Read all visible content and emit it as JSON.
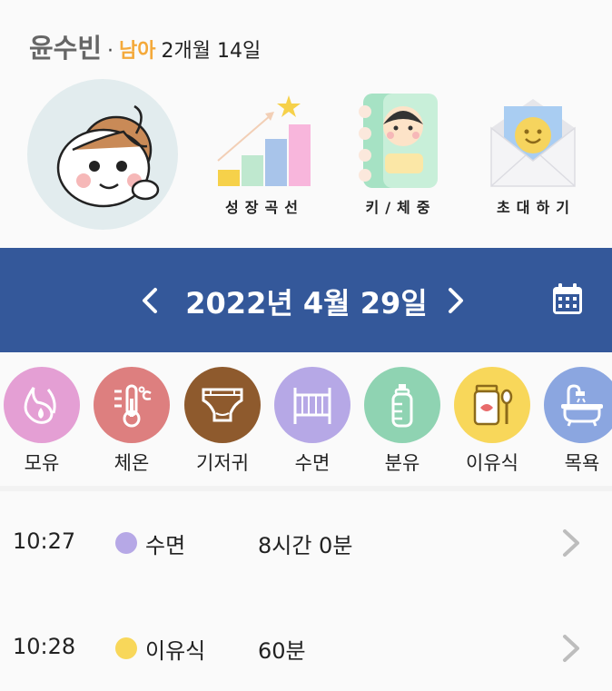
{
  "profile": {
    "name": "윤수빈",
    "separator": "·",
    "gender": "남아",
    "age": "2개월 14일"
  },
  "menu": [
    {
      "label": "성장곡선",
      "icon": "growth-chart-icon"
    },
    {
      "label": "키/체중",
      "icon": "height-weight-book-icon"
    },
    {
      "label": "초대하기",
      "icon": "invite-envelope-icon"
    }
  ],
  "date_bar": {
    "date": "2022년 4월 29일",
    "prev_icon": "chevron-left-icon",
    "next_icon": "chevron-right-icon",
    "calendar_icon": "calendar-icon"
  },
  "categories": [
    {
      "label": "모유",
      "icon": "breast-milk-icon",
      "color": "#e49fd4"
    },
    {
      "label": "체온",
      "icon": "thermometer-icon",
      "color": "#dd7f7f"
    },
    {
      "label": "기저귀",
      "icon": "diaper-icon",
      "color": "#8e5a2d"
    },
    {
      "label": "수면",
      "icon": "crib-icon",
      "color": "#b6a8e6"
    },
    {
      "label": "분유",
      "icon": "baby-bottle-icon",
      "color": "#8fd3b2"
    },
    {
      "label": "이유식",
      "icon": "baby-food-icon",
      "color": "#f8d75a"
    },
    {
      "label": "목욕",
      "icon": "bathtub-icon",
      "color": "#8ba6e0"
    }
  ],
  "records": [
    {
      "time": "10:27",
      "type": "수면",
      "amount": "8시간 0분",
      "color": "#b6a8e6"
    },
    {
      "time": "10:28",
      "type": "이유식",
      "amount": "60분",
      "color": "#f8d75a"
    }
  ]
}
